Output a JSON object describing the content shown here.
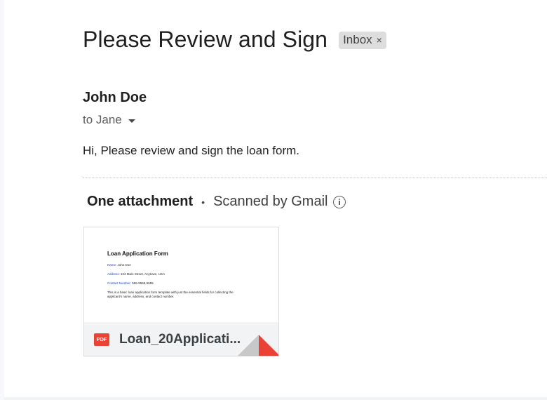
{
  "email": {
    "subject": "Please Review and Sign",
    "label": "Inbox",
    "label_close": "×",
    "sender": "John Doe",
    "recipient": "to Jane",
    "body": "Hi, Please review and sign the loan form."
  },
  "attachments": {
    "count_label": "One attachment",
    "separator": "•",
    "scanned_label": "Scanned by Gmail",
    "items": [
      {
        "filename": "Loan_20Applicati...",
        "file_type": "PDF",
        "preview": {
          "title": "Loan Application Form",
          "name_label": "Name:",
          "name_value": "John Doe",
          "address_label": "Address:",
          "address_value": "123 Main Street, Anytown, USA",
          "contact_label": "Contact Number:",
          "contact_value": "555-5555-5555",
          "desc_line1": "This is a basic loan application form template with just the essential fields for collecting the",
          "desc_line2": "applicant's name, address, and contact number."
        }
      }
    ]
  },
  "colors": {
    "pdf_red": "#ea4335",
    "chip_bg": "#dddddd",
    "preview_key_blue": "#1a3fc4"
  }
}
